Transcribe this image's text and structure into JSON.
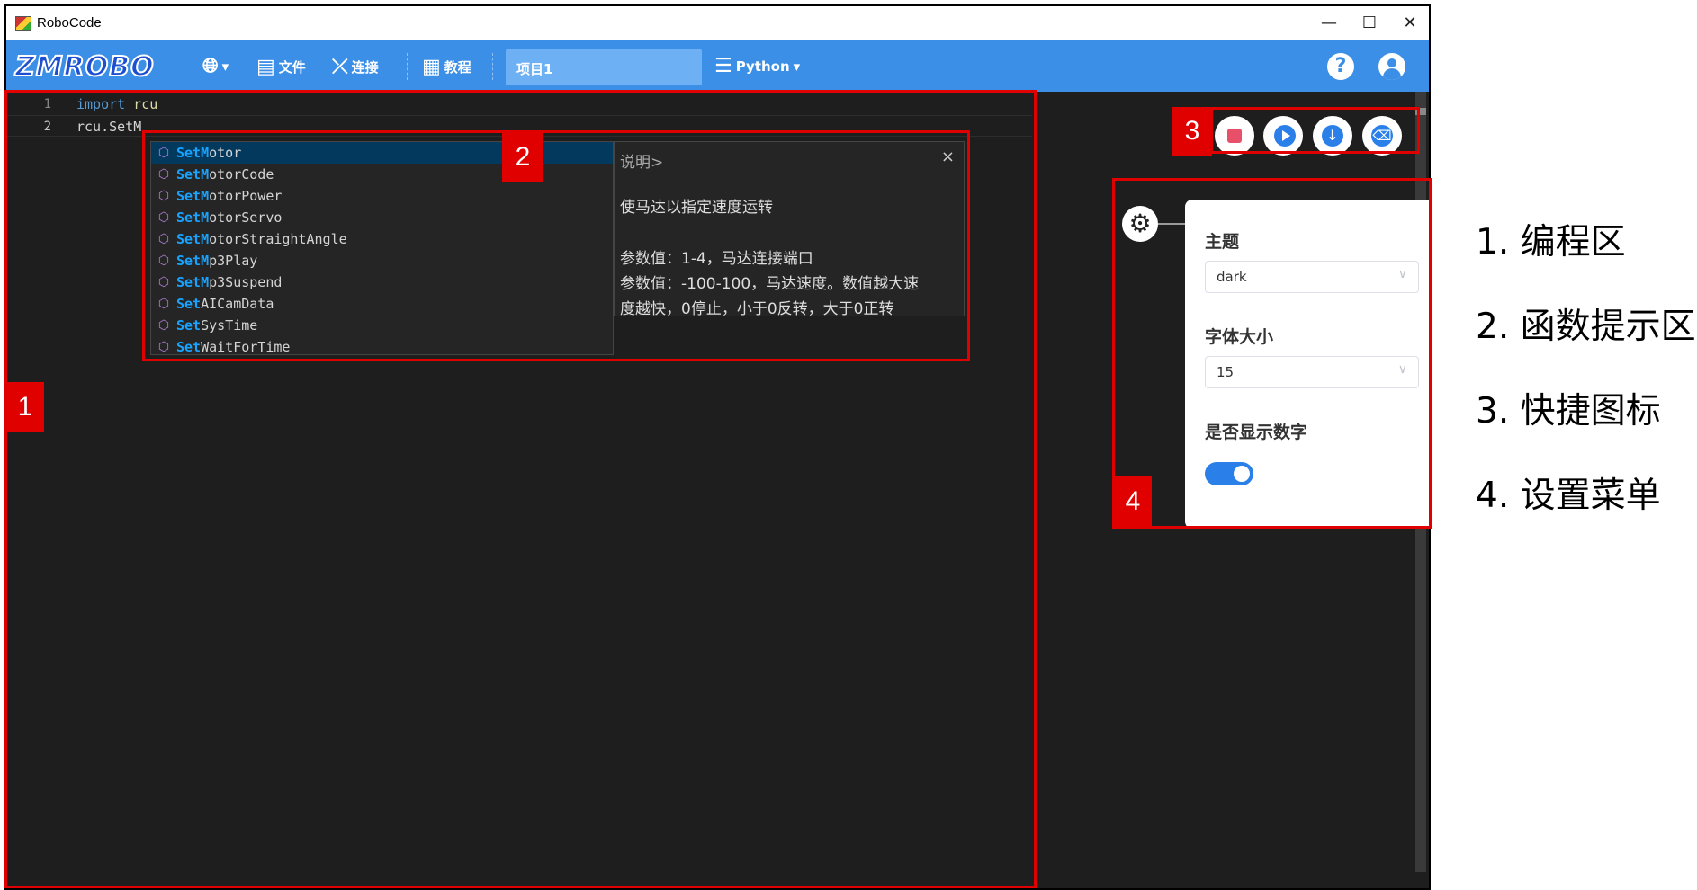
{
  "window": {
    "title": "RoboCode",
    "controls": {
      "minimize": "—",
      "maximize": "☐",
      "close": "✕"
    }
  },
  "toolbar": {
    "logo": "ZMROBO",
    "language_icon": "globe-icon",
    "file_label": "文件",
    "connect_label": "连接",
    "tutorial_label": "教程",
    "project_name": "项目1",
    "language_mode": "Python",
    "help": "?"
  },
  "editor": {
    "lines": [
      {
        "num": "1",
        "keyword": "import",
        "module": "rcu"
      },
      {
        "num": "2",
        "text": "rcu.SetM"
      }
    ]
  },
  "suggestions": [
    {
      "prefix": "SetM",
      "rest": "otor"
    },
    {
      "prefix": "SetM",
      "rest": "otorCode"
    },
    {
      "prefix": "SetM",
      "rest": "otorPower"
    },
    {
      "prefix": "SetM",
      "rest": "otorServo"
    },
    {
      "prefix": "SetM",
      "rest": "otorStraightAngle"
    },
    {
      "prefix": "SetM",
      "rest": "p3Play"
    },
    {
      "prefix": "SetM",
      "rest": "p3Suspend"
    },
    {
      "prefix": "Set",
      "rest": "AICamData"
    },
    {
      "prefix": "Set",
      "rest": "SysTime"
    },
    {
      "prefix": "Set",
      "rest": "WaitForTime"
    }
  ],
  "doc": {
    "title": "说明>",
    "close": "×",
    "summary": "使马达以指定速度运转",
    "param1": "参数值：1-4，马达连接端口",
    "param2_line1": "参数值：-100-100，马达速度。数值越大速",
    "param2_line2": "度越快，0停止，小于0反转，大于0正转"
  },
  "settings": {
    "theme_label": "主题",
    "theme_value": "dark",
    "font_label": "字体大小",
    "font_value": "15",
    "show_numbers_label": "是否显示数字",
    "show_numbers": true
  },
  "annotations": {
    "numbers": [
      "1",
      "2",
      "3",
      "4"
    ],
    "legend": [
      "1. 编程区",
      "2. 函数提示区",
      "3. 快捷图标",
      "4. 设置菜单"
    ],
    "color": "#e00000"
  },
  "colors": {
    "accent": "#3b8fe6",
    "editor_bg": "#1e1e1e"
  }
}
